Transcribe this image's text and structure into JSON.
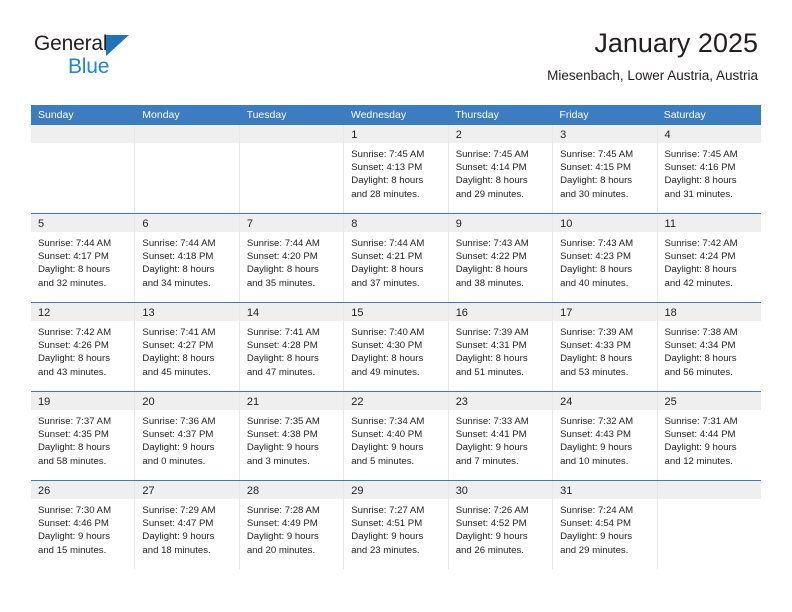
{
  "brand": {
    "name_part1": "General",
    "name_part2": "Blue",
    "triangle_color": "#1e74bb",
    "blue_color": "#1e88d2"
  },
  "header": {
    "title": "January 2025",
    "subtitle": "Miesenbach, Lower Austria, Austria"
  },
  "theme": {
    "header_blue": "#3b7dc0",
    "daynum_band": "#efefef",
    "text": "#231f20"
  },
  "weekdays": [
    "Sunday",
    "Monday",
    "Tuesday",
    "Wednesday",
    "Thursday",
    "Friday",
    "Saturday"
  ],
  "weeks": [
    [
      {
        "day": "",
        "sunrise": "",
        "sunset": "",
        "daylight1": "",
        "daylight2": ""
      },
      {
        "day": "",
        "sunrise": "",
        "sunset": "",
        "daylight1": "",
        "daylight2": ""
      },
      {
        "day": "",
        "sunrise": "",
        "sunset": "",
        "daylight1": "",
        "daylight2": ""
      },
      {
        "day": "1",
        "sunrise": "Sunrise: 7:45 AM",
        "sunset": "Sunset: 4:13 PM",
        "daylight1": "Daylight: 8 hours",
        "daylight2": "and 28 minutes."
      },
      {
        "day": "2",
        "sunrise": "Sunrise: 7:45 AM",
        "sunset": "Sunset: 4:14 PM",
        "daylight1": "Daylight: 8 hours",
        "daylight2": "and 29 minutes."
      },
      {
        "day": "3",
        "sunrise": "Sunrise: 7:45 AM",
        "sunset": "Sunset: 4:15 PM",
        "daylight1": "Daylight: 8 hours",
        "daylight2": "and 30 minutes."
      },
      {
        "day": "4",
        "sunrise": "Sunrise: 7:45 AM",
        "sunset": "Sunset: 4:16 PM",
        "daylight1": "Daylight: 8 hours",
        "daylight2": "and 31 minutes."
      }
    ],
    [
      {
        "day": "5",
        "sunrise": "Sunrise: 7:44 AM",
        "sunset": "Sunset: 4:17 PM",
        "daylight1": "Daylight: 8 hours",
        "daylight2": "and 32 minutes."
      },
      {
        "day": "6",
        "sunrise": "Sunrise: 7:44 AM",
        "sunset": "Sunset: 4:18 PM",
        "daylight1": "Daylight: 8 hours",
        "daylight2": "and 34 minutes."
      },
      {
        "day": "7",
        "sunrise": "Sunrise: 7:44 AM",
        "sunset": "Sunset: 4:20 PM",
        "daylight1": "Daylight: 8 hours",
        "daylight2": "and 35 minutes."
      },
      {
        "day": "8",
        "sunrise": "Sunrise: 7:44 AM",
        "sunset": "Sunset: 4:21 PM",
        "daylight1": "Daylight: 8 hours",
        "daylight2": "and 37 minutes."
      },
      {
        "day": "9",
        "sunrise": "Sunrise: 7:43 AM",
        "sunset": "Sunset: 4:22 PM",
        "daylight1": "Daylight: 8 hours",
        "daylight2": "and 38 minutes."
      },
      {
        "day": "10",
        "sunrise": "Sunrise: 7:43 AM",
        "sunset": "Sunset: 4:23 PM",
        "daylight1": "Daylight: 8 hours",
        "daylight2": "and 40 minutes."
      },
      {
        "day": "11",
        "sunrise": "Sunrise: 7:42 AM",
        "sunset": "Sunset: 4:24 PM",
        "daylight1": "Daylight: 8 hours",
        "daylight2": "and 42 minutes."
      }
    ],
    [
      {
        "day": "12",
        "sunrise": "Sunrise: 7:42 AM",
        "sunset": "Sunset: 4:26 PM",
        "daylight1": "Daylight: 8 hours",
        "daylight2": "and 43 minutes."
      },
      {
        "day": "13",
        "sunrise": "Sunrise: 7:41 AM",
        "sunset": "Sunset: 4:27 PM",
        "daylight1": "Daylight: 8 hours",
        "daylight2": "and 45 minutes."
      },
      {
        "day": "14",
        "sunrise": "Sunrise: 7:41 AM",
        "sunset": "Sunset: 4:28 PM",
        "daylight1": "Daylight: 8 hours",
        "daylight2": "and 47 minutes."
      },
      {
        "day": "15",
        "sunrise": "Sunrise: 7:40 AM",
        "sunset": "Sunset: 4:30 PM",
        "daylight1": "Daylight: 8 hours",
        "daylight2": "and 49 minutes."
      },
      {
        "day": "16",
        "sunrise": "Sunrise: 7:39 AM",
        "sunset": "Sunset: 4:31 PM",
        "daylight1": "Daylight: 8 hours",
        "daylight2": "and 51 minutes."
      },
      {
        "day": "17",
        "sunrise": "Sunrise: 7:39 AM",
        "sunset": "Sunset: 4:33 PM",
        "daylight1": "Daylight: 8 hours",
        "daylight2": "and 53 minutes."
      },
      {
        "day": "18",
        "sunrise": "Sunrise: 7:38 AM",
        "sunset": "Sunset: 4:34 PM",
        "daylight1": "Daylight: 8 hours",
        "daylight2": "and 56 minutes."
      }
    ],
    [
      {
        "day": "19",
        "sunrise": "Sunrise: 7:37 AM",
        "sunset": "Sunset: 4:35 PM",
        "daylight1": "Daylight: 8 hours",
        "daylight2": "and 58 minutes."
      },
      {
        "day": "20",
        "sunrise": "Sunrise: 7:36 AM",
        "sunset": "Sunset: 4:37 PM",
        "daylight1": "Daylight: 9 hours",
        "daylight2": "and 0 minutes."
      },
      {
        "day": "21",
        "sunrise": "Sunrise: 7:35 AM",
        "sunset": "Sunset: 4:38 PM",
        "daylight1": "Daylight: 9 hours",
        "daylight2": "and 3 minutes."
      },
      {
        "day": "22",
        "sunrise": "Sunrise: 7:34 AM",
        "sunset": "Sunset: 4:40 PM",
        "daylight1": "Daylight: 9 hours",
        "daylight2": "and 5 minutes."
      },
      {
        "day": "23",
        "sunrise": "Sunrise: 7:33 AM",
        "sunset": "Sunset: 4:41 PM",
        "daylight1": "Daylight: 9 hours",
        "daylight2": "and 7 minutes."
      },
      {
        "day": "24",
        "sunrise": "Sunrise: 7:32 AM",
        "sunset": "Sunset: 4:43 PM",
        "daylight1": "Daylight: 9 hours",
        "daylight2": "and 10 minutes."
      },
      {
        "day": "25",
        "sunrise": "Sunrise: 7:31 AM",
        "sunset": "Sunset: 4:44 PM",
        "daylight1": "Daylight: 9 hours",
        "daylight2": "and 12 minutes."
      }
    ],
    [
      {
        "day": "26",
        "sunrise": "Sunrise: 7:30 AM",
        "sunset": "Sunset: 4:46 PM",
        "daylight1": "Daylight: 9 hours",
        "daylight2": "and 15 minutes."
      },
      {
        "day": "27",
        "sunrise": "Sunrise: 7:29 AM",
        "sunset": "Sunset: 4:47 PM",
        "daylight1": "Daylight: 9 hours",
        "daylight2": "and 18 minutes."
      },
      {
        "day": "28",
        "sunrise": "Sunrise: 7:28 AM",
        "sunset": "Sunset: 4:49 PM",
        "daylight1": "Daylight: 9 hours",
        "daylight2": "and 20 minutes."
      },
      {
        "day": "29",
        "sunrise": "Sunrise: 7:27 AM",
        "sunset": "Sunset: 4:51 PM",
        "daylight1": "Daylight: 9 hours",
        "daylight2": "and 23 minutes."
      },
      {
        "day": "30",
        "sunrise": "Sunrise: 7:26 AM",
        "sunset": "Sunset: 4:52 PM",
        "daylight1": "Daylight: 9 hours",
        "daylight2": "and 26 minutes."
      },
      {
        "day": "31",
        "sunrise": "Sunrise: 7:24 AM",
        "sunset": "Sunset: 4:54 PM",
        "daylight1": "Daylight: 9 hours",
        "daylight2": "and 29 minutes."
      },
      {
        "day": "",
        "sunrise": "",
        "sunset": "",
        "daylight1": "",
        "daylight2": ""
      }
    ]
  ]
}
